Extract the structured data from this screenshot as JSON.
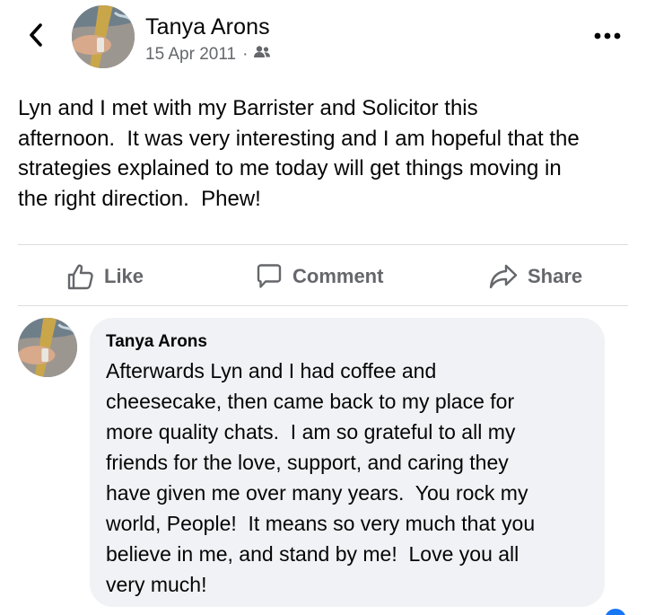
{
  "post": {
    "author": "Tanya Arons",
    "date": "15 Apr 2011",
    "separator": "·",
    "audience_icon": "friends-icon",
    "text": "Lyn and I met with my Barrister and Solicitor this\nafternoon.  It was very interesting and I am hopeful that the\nstrategies explained to me today will get things moving in\nthe right direction.  Phew!"
  },
  "actions": {
    "like": "Like",
    "comment": "Comment",
    "share": "Share"
  },
  "comment": {
    "author": "Tanya Arons",
    "text": "Afterwards Lyn and I had coffee and\ncheesecake, then came back to my place for\nmore quality chats.  I am so grateful to all my\nfriends for the love, support, and caring they\nhave given me over many years.  You rock my\nworld, People!  It means so very much that you\nbelieve in me, and stand by me!  Love you all\nvery much!"
  },
  "colors": {
    "text_primary": "#050505",
    "text_secondary": "#65676b",
    "bubble_bg": "#f0f2f5",
    "divider": "#dadde1",
    "accent": "#1877f2"
  }
}
